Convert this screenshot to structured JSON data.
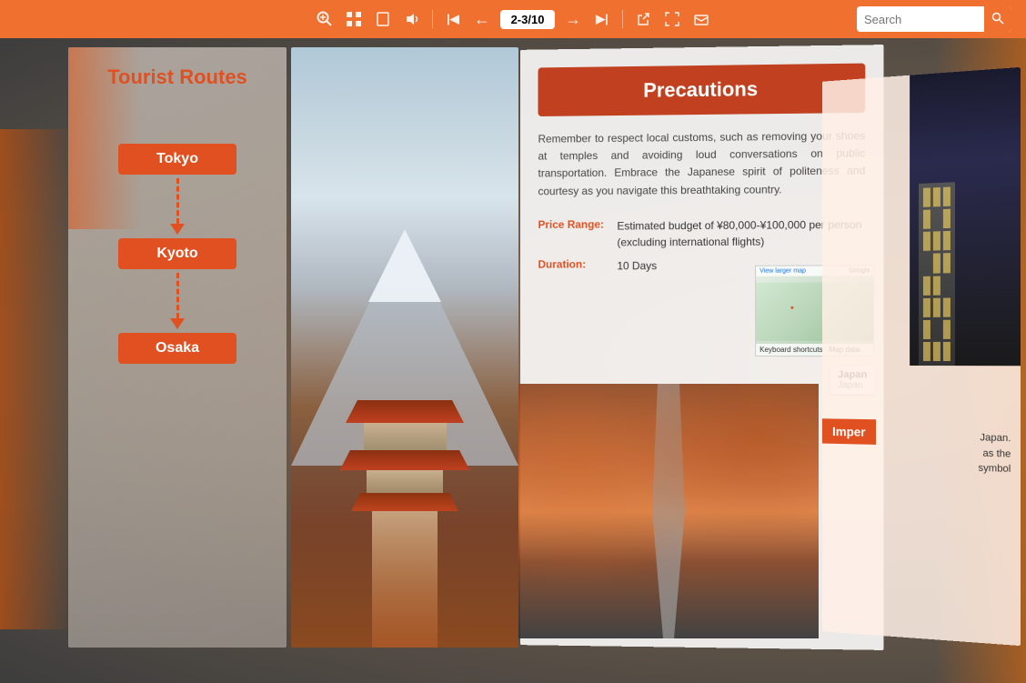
{
  "toolbar": {
    "zoom_in_icon": "🔍",
    "grid_icon": "⊞",
    "page_icon": "▭",
    "audio_icon": "🔊",
    "first_page_icon": "|←",
    "prev_page_icon": "←",
    "page_indicator": "2-3/10",
    "next_page_icon": "→",
    "last_page_icon": "→|",
    "export_icon": "⇗",
    "fullscreen_icon": "⤢",
    "share_icon": "✉",
    "search_placeholder": "Search"
  },
  "left_page": {
    "title": "Tourist Routes",
    "routes": [
      {
        "name": "Tokyo"
      },
      {
        "name": "Kyoto"
      },
      {
        "name": "Osaka"
      }
    ]
  },
  "right_page": {
    "section_title": "Precautions",
    "description": "Remember to respect local customs, such as removing your shoes at temples and avoiding loud conversations on public transportation. Embrace the Japanese spirit of politeness and courtesy as you navigate this breathtaking country.",
    "price_range_label": "Price Range:",
    "price_range_value": "Estimated budget of ¥80,000-¥100,000 per person (excluding international flights)",
    "duration_label": "Duration:",
    "duration_value": "10 Days",
    "map_top_label": "View larger map",
    "map_google_label": "Google",
    "map_keyboard": "Keyboard shortcuts",
    "map_data": "Map data",
    "japan_name": "Japan",
    "japan_country": "Japan"
  },
  "far_right_page": {
    "badge_text": "Imper",
    "text_lines": [
      "Japan.",
      "as the",
      "symbol"
    ]
  }
}
